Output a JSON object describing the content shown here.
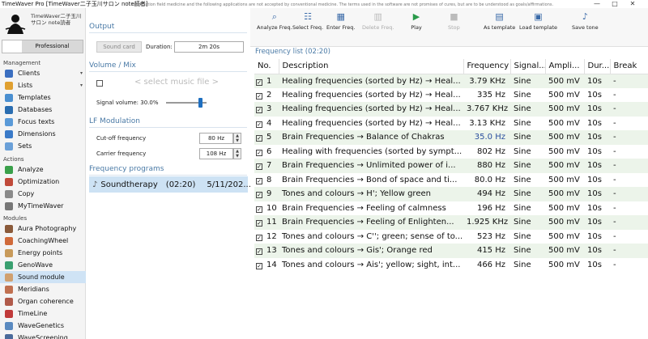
{
  "window": {
    "title": "TimeWaver Pro [TimeWaver二子玉川サロン note読者]",
    "controls": [
      "—",
      "□",
      "✕"
    ]
  },
  "brand": {
    "text": "TimeWaver二子玉川サロン note読者"
  },
  "profile_button": "Professional",
  "sidebar": {
    "management_header": "Management",
    "management": [
      {
        "label": "Clients",
        "icon": "clients-icon",
        "color": "#3b6fc0",
        "arrow": "▾"
      },
      {
        "label": "Lists",
        "icon": "lists-icon",
        "color": "#e0a030",
        "arrow": "▾"
      },
      {
        "label": "Templates",
        "icon": "templates-icon",
        "color": "#4a8fd0"
      },
      {
        "label": "Databases",
        "icon": "databases-icon",
        "color": "#2a6db0"
      },
      {
        "label": "Focus texts",
        "icon": "focus-texts-icon",
        "color": "#5a9ad8"
      },
      {
        "label": "Dimensions",
        "icon": "dimensions-icon",
        "color": "#3a7ac8"
      },
      {
        "label": "Sets",
        "icon": "sets-icon",
        "color": "#6aa0d8"
      }
    ],
    "actions_header": "Actions",
    "actions": [
      {
        "label": "Analyze",
        "icon": "analyze-icon",
        "color": "#3aa04a"
      },
      {
        "label": "Optimization",
        "icon": "optimization-icon",
        "color": "#c04a3a"
      },
      {
        "label": "Copy",
        "icon": "copy-icon",
        "color": "#8a8a8a"
      },
      {
        "label": "MyTimeWaver",
        "icon": "mytimewaver-icon",
        "color": "#777"
      }
    ],
    "modules_header": "Modules",
    "modules": [
      {
        "label": "Aura Photography",
        "icon": "aura-photography-icon",
        "color": "#8a5a3a"
      },
      {
        "label": "CoachingWheel",
        "icon": "coachingwheel-icon",
        "color": "#d06a3a"
      },
      {
        "label": "Energy points",
        "icon": "energy-points-icon",
        "color": "#c89a5a"
      },
      {
        "label": "GenoWave",
        "icon": "genowave-icon",
        "color": "#3aa070"
      },
      {
        "label": "Sound module",
        "icon": "sound-module-icon",
        "color": "#d0a070",
        "active": true
      },
      {
        "label": "Meridians",
        "icon": "meridians-icon",
        "color": "#c07050"
      },
      {
        "label": "Organ coherence",
        "icon": "organ-coherence-icon",
        "color": "#b05a4a"
      },
      {
        "label": "TimeLine",
        "icon": "timeline-icon",
        "color": "#c03a3a"
      },
      {
        "label": "WaveGenetics",
        "icon": "wavegenetics-icon",
        "color": "#5a8ac0"
      },
      {
        "label": "WaveScreening",
        "icon": "wavescreening-icon",
        "color": "#4a6a9a"
      }
    ]
  },
  "output": {
    "header": "Output",
    "soundcard": "Sound card",
    "duration_label": "Duration:",
    "duration_value": "2m 20s"
  },
  "volume": {
    "header": "Volume / Mix",
    "music_placeholder": "< select music file >",
    "signal_volume": "Signal volume: 30.0%",
    "signal_volume_level": 0.3
  },
  "lf": {
    "header": "LF Modulation",
    "cutoff_label": "Cut-off frequency",
    "cutoff_value": "80 Hz",
    "carrier_label": "Carrier frequency",
    "carrier_value": "108 Hz"
  },
  "programs": {
    "header": "Frequency programs",
    "items": [
      {
        "name": "Soundtherapy",
        "duration": "(02:20)",
        "date": "5/11/202..."
      }
    ]
  },
  "toolbar": [
    {
      "label": "Analyze Freq.",
      "icon": "search-icon",
      "glyph": "⌕"
    },
    {
      "label": "Select Freq.",
      "icon": "select-freq-icon",
      "glyph": "☷"
    },
    {
      "label": "Enter Freq.",
      "icon": "enter-freq-icon",
      "glyph": "▦"
    },
    {
      "label": "Delete Freq.",
      "icon": "delete-freq-icon",
      "glyph": "▥",
      "disabled": true
    },
    {
      "label": "Play",
      "icon": "play-icon",
      "glyph": "▶"
    },
    {
      "label": "Stop",
      "icon": "stop-icon",
      "glyph": "■",
      "disabled": true
    },
    {
      "label": "As template",
      "icon": "template-icon",
      "glyph": "▤"
    },
    {
      "label": "Load template",
      "icon": "load-template-icon",
      "glyph": "▣"
    },
    {
      "label": "Save tone",
      "icon": "save-tone-icon",
      "glyph": "♪"
    }
  ],
  "frequency_list_title": "Frequency list  (02:20)",
  "table": {
    "headers": [
      "No.",
      "Description",
      "Frequency",
      "Signal...",
      "Ampli...",
      "Dur...",
      "Break"
    ],
    "rows": [
      {
        "no": "1",
        "desc": "Healing frequencies (sorted by Hz) → Heal...",
        "freq": "3.79 KHz",
        "signal": "Sine",
        "amp": "500 mV",
        "dur": "10s",
        "brk": "-"
      },
      {
        "no": "2",
        "desc": "Healing frequencies (sorted by Hz) → Heal...",
        "freq": "335 Hz",
        "signal": "Sine",
        "amp": "500 mV",
        "dur": "10s",
        "brk": "-"
      },
      {
        "no": "3",
        "desc": "Healing frequencies (sorted by Hz) → Heal...",
        "freq": "3.767 KHz",
        "signal": "Sine",
        "amp": "500 mV",
        "dur": "10s",
        "brk": "-"
      },
      {
        "no": "4",
        "desc": "Healing frequencies (sorted by Hz) → Heal...",
        "freq": "3.13 KHz",
        "signal": "Sine",
        "amp": "500 mV",
        "dur": "10s",
        "brk": "-"
      },
      {
        "no": "5",
        "desc": "Brain Frequencies → Balance of Chakras",
        "freq": "35.0 Hz",
        "signal": "Sine",
        "amp": "500 mV",
        "dur": "10s",
        "brk": "-",
        "blue": true
      },
      {
        "no": "6",
        "desc": "Healing with frequencies (sorted by sympt...",
        "freq": "802 Hz",
        "signal": "Sine",
        "amp": "500 mV",
        "dur": "10s",
        "brk": "-"
      },
      {
        "no": "7",
        "desc": "Brain Frequencies → Unlimited power of i...",
        "freq": "880 Hz",
        "signal": "Sine",
        "amp": "500 mV",
        "dur": "10s",
        "brk": "-"
      },
      {
        "no": "8",
        "desc": "Brain Frequencies → Bond of space and ti...",
        "freq": "80.0 Hz",
        "signal": "Sine",
        "amp": "500 mV",
        "dur": "10s",
        "brk": "-"
      },
      {
        "no": "9",
        "desc": "Tones and colours → H'; Yellow green",
        "freq": "494 Hz",
        "signal": "Sine",
        "amp": "500 mV",
        "dur": "10s",
        "brk": "-"
      },
      {
        "no": "10",
        "desc": "Brain Frequencies → Feeling of calmness",
        "freq": "196 Hz",
        "signal": "Sine",
        "amp": "500 mV",
        "dur": "10s",
        "brk": "-"
      },
      {
        "no": "11",
        "desc": "Brain Frequencies → Feeling of Enlighten...",
        "freq": "1.925 KHz",
        "signal": "Sine",
        "amp": "500 mV",
        "dur": "10s",
        "brk": "-"
      },
      {
        "no": "12",
        "desc": "Tones and colours → C''; green; sense of to...",
        "freq": "523 Hz",
        "signal": "Sine",
        "amp": "500 mV",
        "dur": "10s",
        "brk": "-"
      },
      {
        "no": "13",
        "desc": "Tones and colours → Gis'; Orange red",
        "freq": "415 Hz",
        "signal": "Sine",
        "amp": "500 mV",
        "dur": "10s",
        "brk": "-"
      },
      {
        "no": "14",
        "desc": "Tones and colours → Ais'; yellow; sight, int...",
        "freq": "466 Hz",
        "signal": "Sine",
        "amp": "500 mV",
        "dur": "10s",
        "brk": "-"
      }
    ]
  },
  "disclaimer": "Information field medicine and the following applications are not accepted by conventional medicine. The terms used in the software are not promises of cures, but are to be understood as goals/affirmations."
}
